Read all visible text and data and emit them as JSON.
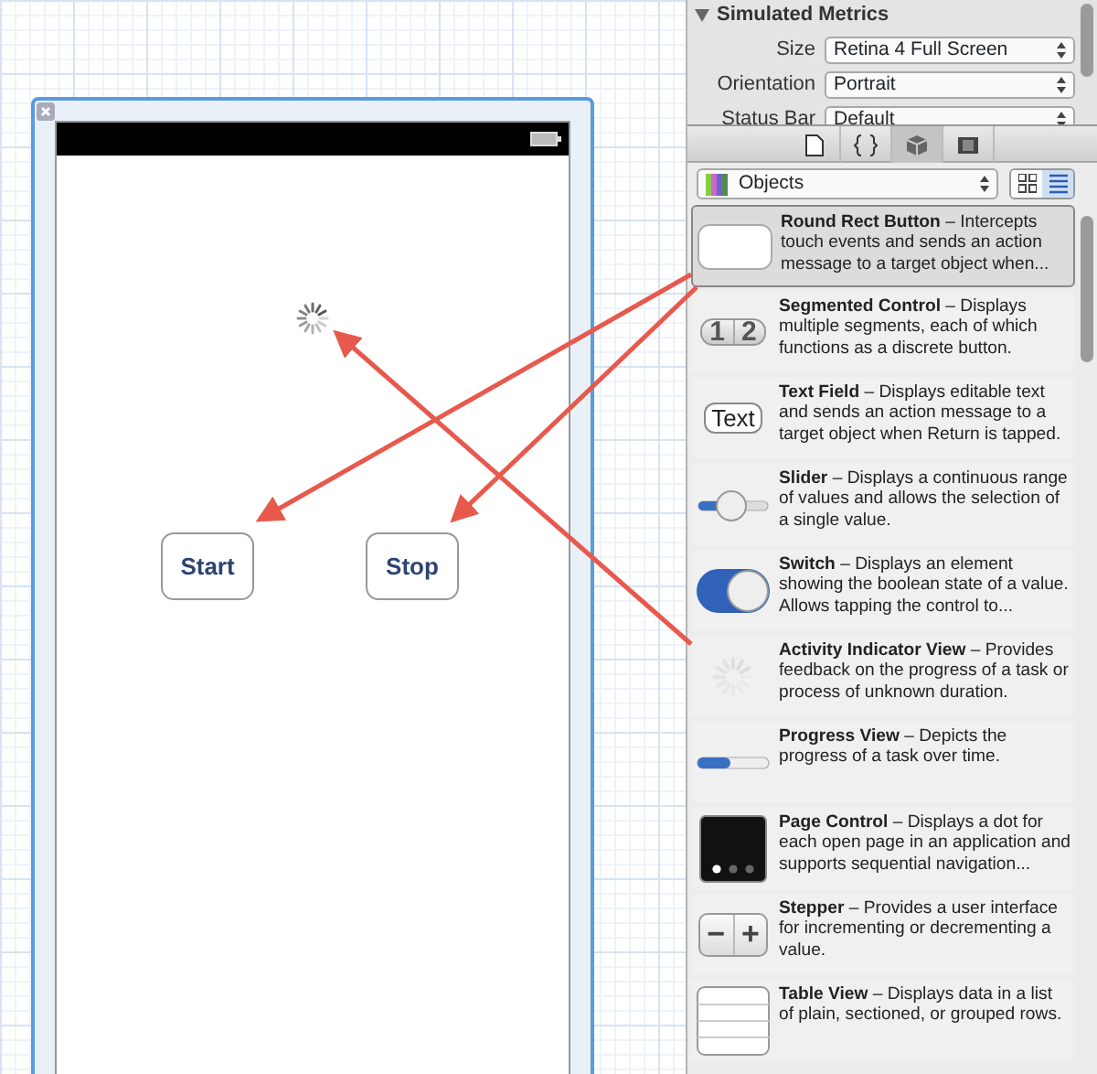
{
  "canvas": {
    "buttons": [
      {
        "label": "Start"
      },
      {
        "label": "Stop"
      }
    ]
  },
  "simulated_metrics": {
    "title": "Simulated Metrics",
    "expanded": true,
    "rows": [
      {
        "label": "Size",
        "value": "Retina 4 Full Screen"
      },
      {
        "label": "Orientation",
        "value": "Portrait"
      },
      {
        "label": "Status Bar",
        "value": "Default"
      }
    ]
  },
  "library_tabs": [
    {
      "kind": "file",
      "selected": false
    },
    {
      "kind": "code",
      "selected": false
    },
    {
      "kind": "object",
      "selected": true
    },
    {
      "kind": "media",
      "selected": false
    }
  ],
  "library_filter": {
    "value": "Objects"
  },
  "view_modes": [
    {
      "kind": "grid",
      "selected": false
    },
    {
      "kind": "list",
      "selected": true
    }
  ],
  "objects": [
    {
      "kind": "roundrect",
      "title": "Round Rect Button",
      "description": "– Intercepts touch events and sends an action message to a target object when...",
      "selected": true
    },
    {
      "kind": "segmented",
      "title": "Segmented Control",
      "description": "– Displays multiple segments, each of which functions as a discrete button.",
      "selected": false,
      "segments": [
        "1",
        "2"
      ]
    },
    {
      "kind": "textfield",
      "title": "Text Field",
      "description": "– Displays editable text and sends an action message to a target object when Return is tapped.",
      "selected": false,
      "sample": "Text"
    },
    {
      "kind": "slider",
      "title": "Slider",
      "description": "– Displays a continuous range of values and allows the selection of a single value.",
      "selected": false
    },
    {
      "kind": "switch",
      "title": "Switch",
      "description": "– Displays an element showing the boolean state of a value. Allows tapping the control to...",
      "selected": false
    },
    {
      "kind": "activity",
      "title": "Activity Indicator View",
      "description": "– Provides feedback on the progress of a task or process of unknown duration.",
      "selected": false
    },
    {
      "kind": "progress",
      "title": "Progress View",
      "description": "– Depicts the progress of a task over time.",
      "selected": false
    },
    {
      "kind": "pagecontrol",
      "title": "Page Control",
      "description": "– Displays a dot for each open page in an application and supports sequential navigation...",
      "selected": false
    },
    {
      "kind": "stepper",
      "title": "Stepper",
      "description": "– Provides a user interface for incrementing or decrementing a value.",
      "selected": false,
      "minus": "−",
      "plus": "+"
    },
    {
      "kind": "table",
      "title": "Table View",
      "description": "– Displays data in a list of plain, sectioned, or grouped rows.",
      "selected": false
    }
  ]
}
